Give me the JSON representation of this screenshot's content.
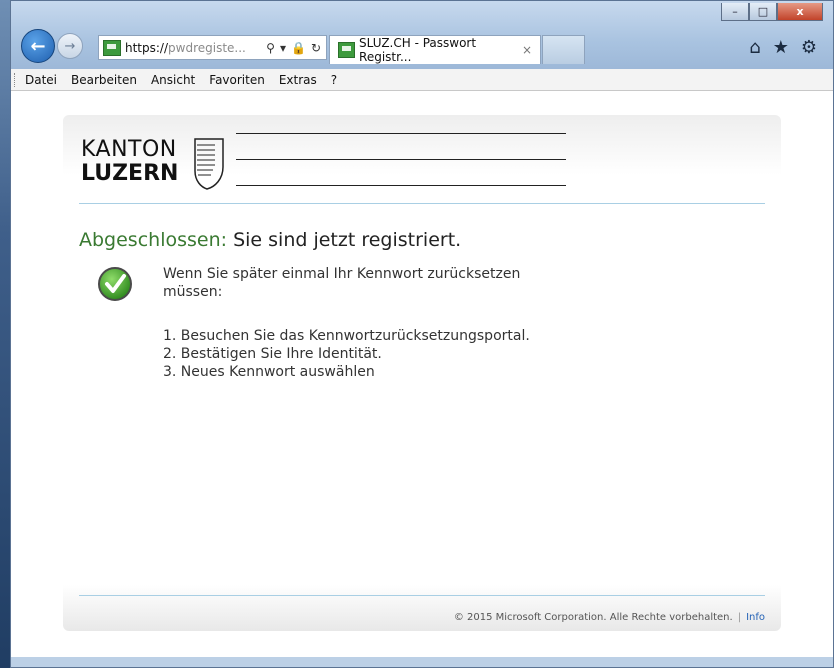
{
  "browser": {
    "address": {
      "scheme": "https://",
      "host": "pwdregiste...",
      "search_icon": "search-icon",
      "dropdown_icon": "chevron-down-icon",
      "lock_icon": "lock-icon",
      "refresh_icon": "refresh-icon"
    },
    "tab": {
      "title": "SLUZ.CH - Passwort Registr...",
      "close": "×"
    },
    "right_icons": [
      "home-icon",
      "star-icon",
      "gear-icon"
    ],
    "window_controls": {
      "minimize": "–",
      "maximize": "□",
      "close": "x"
    },
    "menu": [
      "Datei",
      "Bearbeiten",
      "Ansicht",
      "Favoriten",
      "Extras",
      "?"
    ]
  },
  "page": {
    "logo": {
      "line1": "KANTON",
      "line2": "LUZERN"
    },
    "heading": {
      "status": "Abgeschlossen:",
      "text": "Sie sind jetzt registriert."
    },
    "message": "Wenn Sie später einmal Ihr Kennwort zurücksetzen müssen:",
    "steps": [
      "1.  Besuchen Sie das Kennwortzurücksetzungsportal.",
      "2.  Bestätigen Sie Ihre Identität.",
      "3.  Neues Kennwort auswählen"
    ],
    "footer": {
      "copyright": "© 2015 Microsoft Corporation. Alle Rechte vorbehalten.",
      "separator": "|",
      "info": "Info"
    }
  },
  "colors": {
    "accent_green": "#3a7a32",
    "link_blue": "#2563b6",
    "divider": "#a9cfe4"
  }
}
